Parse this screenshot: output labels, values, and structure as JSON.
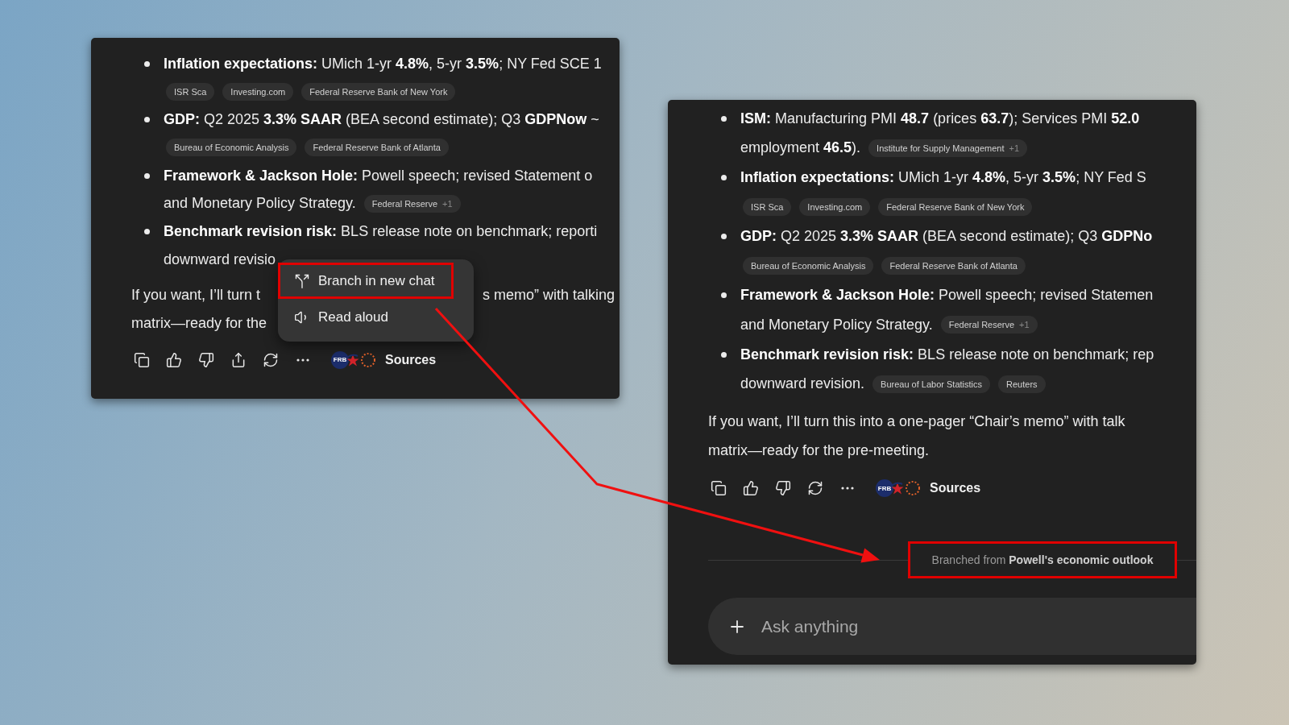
{
  "left_panel": {
    "bullets": [
      {
        "lines": [
          {
            "text": "**Inflation expectations:** UMich 1-yr **4.8%**, 5-yr **3.5%**; NY Fed SCE 1"
          },
          {
            "chips": [
              {
                "label": "ISR Sca"
              },
              {
                "label": "Investing.com"
              },
              {
                "label": "Federal Reserve Bank of New York"
              }
            ]
          }
        ]
      },
      {
        "lines": [
          {
            "text": "**GDP:** Q2 2025 **3.3% SAAR** (BEA second estimate); Q3 **GDPNow** ~"
          },
          {
            "chips": [
              {
                "label": "Bureau of Economic Analysis"
              },
              {
                "label": "Federal Reserve Bank of Atlanta"
              }
            ]
          }
        ]
      },
      {
        "lines": [
          {
            "text": "**Framework & Jackson Hole:** Powell speech; revised Statement o"
          },
          {
            "text": "and Monetary Policy Strategy.",
            "chips": [
              {
                "label": "Federal Reserve",
                "extra": "+1"
              }
            ]
          }
        ]
      },
      {
        "lines": [
          {
            "text": "**Benchmark revision risk:** BLS release note on benchmark; reporti"
          },
          {
            "text": "downward revisio"
          }
        ]
      }
    ],
    "paragraph": [
      {
        "parts": [
          "If you want, I’ll turn t",
          "s memo” with talking"
        ]
      },
      {
        "parts": [
          "matrix—ready for the"
        ]
      }
    ],
    "actions": [
      {
        "kind": "copy"
      },
      {
        "kind": "like"
      },
      {
        "kind": "dislike"
      },
      {
        "kind": "share"
      },
      {
        "kind": "regenerate"
      },
      {
        "kind": "more"
      }
    ],
    "sources": {
      "logo_text": "FRB",
      "label": "Sources"
    },
    "menu": [
      {
        "kind": "branch",
        "label": "Branch in new chat",
        "highlighted": true
      },
      {
        "kind": "speaker",
        "label": "Read aloud",
        "highlighted": false
      }
    ]
  },
  "right_panel": {
    "bullets": [
      {
        "lines": [
          {
            "text": "**ISM:** Manufacturing PMI **48.7** (prices **63.7**); Services PMI **52.0**"
          },
          {
            "text": "employment **46.5**).",
            "chips": [
              {
                "label": "Institute for Supply Management",
                "extra": "+1"
              }
            ]
          }
        ]
      },
      {
        "lines": [
          {
            "text": "**Inflation expectations:** UMich 1-yr **4.8%**, 5-yr **3.5%**; NY Fed S"
          },
          {
            "chips": [
              {
                "label": "ISR Sca"
              },
              {
                "label": "Investing.com"
              },
              {
                "label": "Federal Reserve Bank of New York"
              }
            ]
          }
        ]
      },
      {
        "lines": [
          {
            "text": "**GDP:** Q2 2025 **3.3% SAAR** (BEA second estimate); Q3 **GDPNo**"
          },
          {
            "chips": [
              {
                "label": "Bureau of Economic Analysis"
              },
              {
                "label": "Federal Reserve Bank of Atlanta"
              }
            ]
          }
        ]
      },
      {
        "lines": [
          {
            "text": "**Framework & Jackson Hole:** Powell speech; revised Statemen"
          },
          {
            "text": "and Monetary Policy Strategy.",
            "chips": [
              {
                "label": "Federal Reserve",
                "extra": "+1"
              }
            ]
          }
        ]
      },
      {
        "lines": [
          {
            "text": "**Benchmark revision risk:** BLS release note on benchmark; rep"
          },
          {
            "text": "downward revision.",
            "chips": [
              {
                "label": "Bureau of Labor Statistics"
              },
              {
                "label": "Reuters"
              }
            ]
          }
        ]
      }
    ],
    "paragraph": [
      {
        "parts": [
          "If you want, I’ll turn this into a one-pager “Chair’s memo” with talk"
        ]
      },
      {
        "parts": [
          "matrix—ready for the pre-meeting."
        ]
      }
    ],
    "actions": [
      {
        "kind": "copy"
      },
      {
        "kind": "like"
      },
      {
        "kind": "dislike"
      },
      {
        "kind": "regenerate"
      },
      {
        "kind": "more"
      }
    ],
    "sources": {
      "logo_text": "FRB",
      "label": "Sources"
    },
    "branch_note": {
      "text": "Branched from **Powell's economic outlook**",
      "highlighted": true
    },
    "composer": {
      "placeholder": "Ask anything"
    }
  }
}
